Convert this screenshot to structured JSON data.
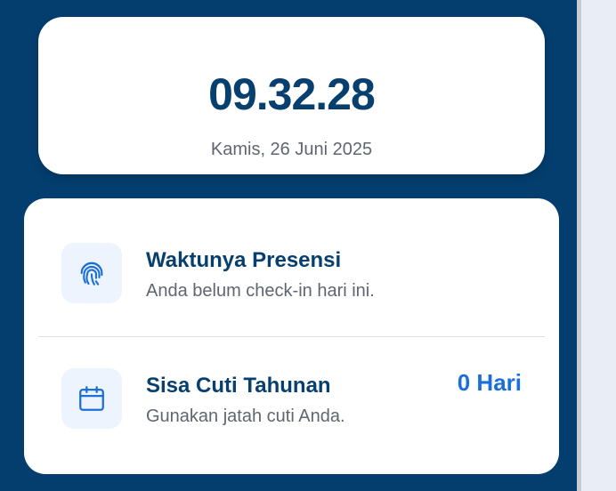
{
  "clock": {
    "time": "09.32.28",
    "date": "Kamis, 26 Juni 2025"
  },
  "attendance": {
    "title": "Waktunya Presensi",
    "subtitle": "Anda belum check-in hari ini.",
    "icon": "fingerprint-icon"
  },
  "leave": {
    "title": "Sisa Cuti Tahunan",
    "subtitle": "Gunakan jatah cuti Anda.",
    "value": "0 Hari",
    "icon": "calendar-icon"
  },
  "colors": {
    "panel_background": "#043e6f",
    "primary_text": "#073f6e",
    "accent": "#1a6fd9",
    "icon_background": "#edf4fd"
  }
}
